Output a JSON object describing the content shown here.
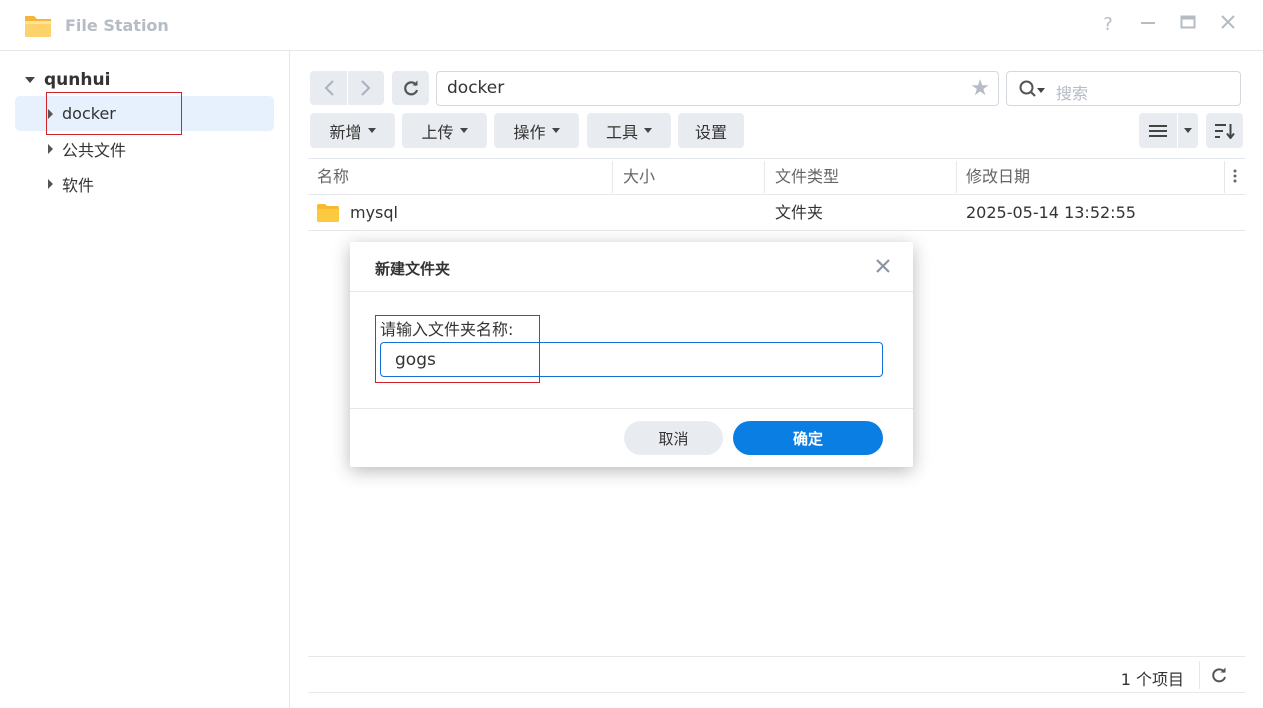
{
  "window": {
    "title": "File Station",
    "help_icon": "question-icon",
    "minimize_icon": "minimize-icon",
    "maximize_icon": "maximize-icon",
    "close_icon": "close-icon"
  },
  "tree": {
    "root": "qunhui",
    "items": [
      {
        "label": "docker",
        "selected": true
      },
      {
        "label": "公共文件",
        "selected": false
      },
      {
        "label": "软件",
        "selected": false
      }
    ]
  },
  "toolbar": {
    "path": "docker",
    "search_placeholder": "搜索",
    "buttons": {
      "new": "新增",
      "upload": "上传",
      "actions": "操作",
      "tools": "工具",
      "settings": "设置"
    }
  },
  "table": {
    "columns": [
      "名称",
      "大小",
      "文件类型",
      "修改日期"
    ],
    "rows": [
      {
        "name": "mysql",
        "size": "",
        "type": "文件夹",
        "modified": "2025-05-14 13:52:55"
      }
    ]
  },
  "footer": {
    "count": "1 个项目"
  },
  "dialog": {
    "title": "新建文件夹",
    "label": "请输入文件夹名称:",
    "value": "gogs",
    "cancel": "取消",
    "ok": "确定"
  },
  "colors": {
    "accent": "#0b7ee3",
    "selection": "#e6f1fd",
    "highlight_box": "#d0222a",
    "folder": "#f8c545"
  }
}
